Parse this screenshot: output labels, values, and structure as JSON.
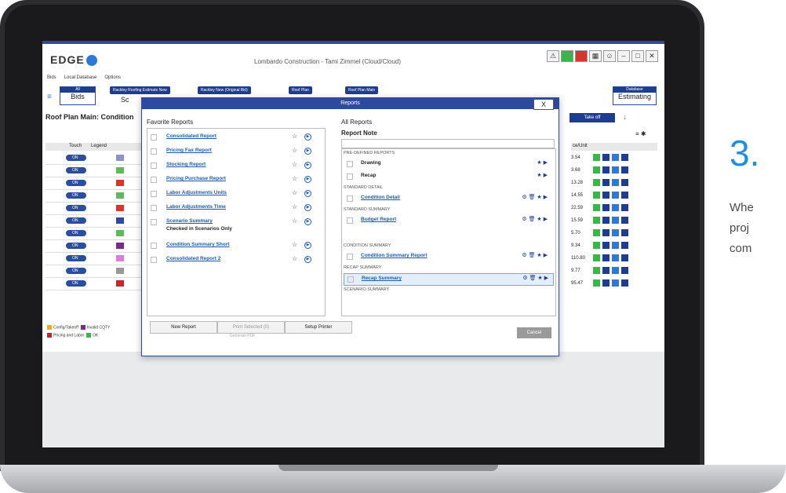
{
  "app": {
    "logo_small": "Pro",
    "logo": "EDGE",
    "title": "Lombardo Construction - Tami Zimmel (Cloud/Cloud)",
    "menu": [
      "Bids",
      "Local Database",
      "Options"
    ]
  },
  "toolbar": {
    "bids_small": "All",
    "bids_label": "Bids",
    "tabs": [
      "Rackley Roofing Estimate New",
      "Rackley New (Original Bid)",
      "Roof Plan",
      "Roof Plan Main"
    ],
    "db_small": "Database",
    "db_label": "Estimating",
    "hidden_label": "Sc"
  },
  "page": {
    "title": "Roof Plan Main: Condition",
    "takeoff": "Take off",
    "grid_headers": [
      "Touch",
      "Legend"
    ],
    "price_header": "ce/Unit",
    "on_label": "ON",
    "prices": [
      "3.54",
      "3.68",
      "13.28",
      "14.55",
      "22.59",
      "15.59",
      "5.70",
      "9.34",
      "110.80",
      "9.77",
      "95.47"
    ]
  },
  "legend": {
    "items": [
      {
        "label": "Config/Takeoff",
        "color": "#f5a623"
      },
      {
        "label": "Invalid CQTY",
        "color": "#7b2a8c"
      },
      {
        "label": "Pricing and Labor",
        "color": "#c1272d"
      },
      {
        "label": "OK",
        "color": "#39b54a"
      }
    ]
  },
  "dialog": {
    "title": "Reports",
    "close": "X",
    "favorite_title": "Favorite Reports",
    "favorites": [
      {
        "label": "Consolidated Report",
        "type": "link"
      },
      {
        "label": "Pricing Fax Report",
        "type": "link"
      },
      {
        "label": "Stocking Report",
        "type": "link"
      },
      {
        "label": "Pricing Purchase Report",
        "type": "link"
      },
      {
        "label": "Labor Adjustments Units",
        "type": "link"
      },
      {
        "label": "Labor Adjustments Time",
        "type": "link"
      },
      {
        "label": "Scenario Summary",
        "type": "link"
      },
      {
        "label": "Checked in Scenarios Only",
        "type": "note"
      },
      {
        "label": "Condition Summary Short",
        "type": "link"
      },
      {
        "label": "Consolidated Report 2",
        "type": "link"
      }
    ],
    "all_title": "All Reports",
    "report_note": "Report Note",
    "sections": [
      {
        "name": "PRE-DEFINED REPORTS",
        "items": [
          {
            "label": "Drawing",
            "link": false
          },
          {
            "label": "Recap",
            "link": false
          }
        ]
      },
      {
        "name": "STANDARD DETAIL",
        "items": [
          {
            "label": "Condition Detail",
            "link": true
          }
        ]
      },
      {
        "name": "STANDARD SUMMARY",
        "items": [
          {
            "label": "Budget Report",
            "link": true
          }
        ]
      },
      {
        "name": "CONDITION SUMMARY",
        "items": [
          {
            "label": "Condition Summary Report",
            "link": true
          }
        ]
      },
      {
        "name": "RECAP SUMMARY",
        "items": [
          {
            "label": "Recap Summary",
            "link": true
          }
        ]
      },
      {
        "name": "SCENARIO SUMMARY",
        "items": []
      }
    ],
    "buttons": {
      "new_report": "New Report",
      "print_selected": "Print Selected (0)",
      "setup_printer": "Setup Printer",
      "generate_pdf": "Generate PDF",
      "cancel": "Cancel"
    }
  },
  "marketing": {
    "step": "3.",
    "lines": [
      "Whe",
      "proj",
      "com"
    ]
  }
}
